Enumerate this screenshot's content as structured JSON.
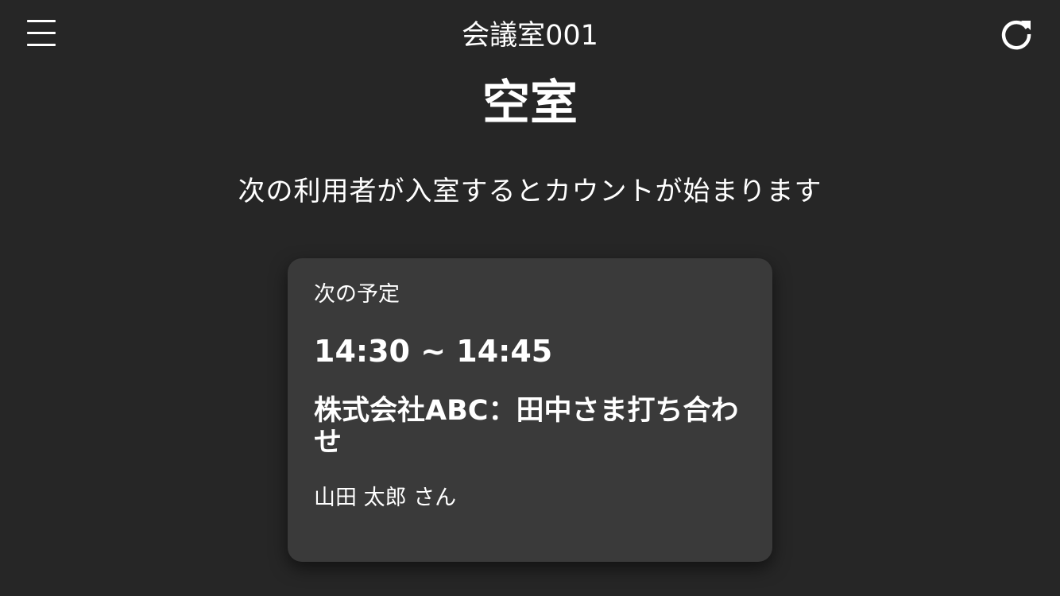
{
  "header": {
    "room_name": "会議室001",
    "menu_icon": "hamburger-menu-icon",
    "refresh_icon": "refresh-icon"
  },
  "status": {
    "title": "空室",
    "message": "次の利用者が入室するとカウントが始まります"
  },
  "next_schedule": {
    "label": "次の予定",
    "time": "14:30 ~ 14:45",
    "title": "株式会社ABC：田中さま打ち合わせ",
    "organizer": "山田 太郎 さん"
  },
  "colors": {
    "background": "#262626",
    "card": "#3a3a3a",
    "text": "#ffffff"
  }
}
